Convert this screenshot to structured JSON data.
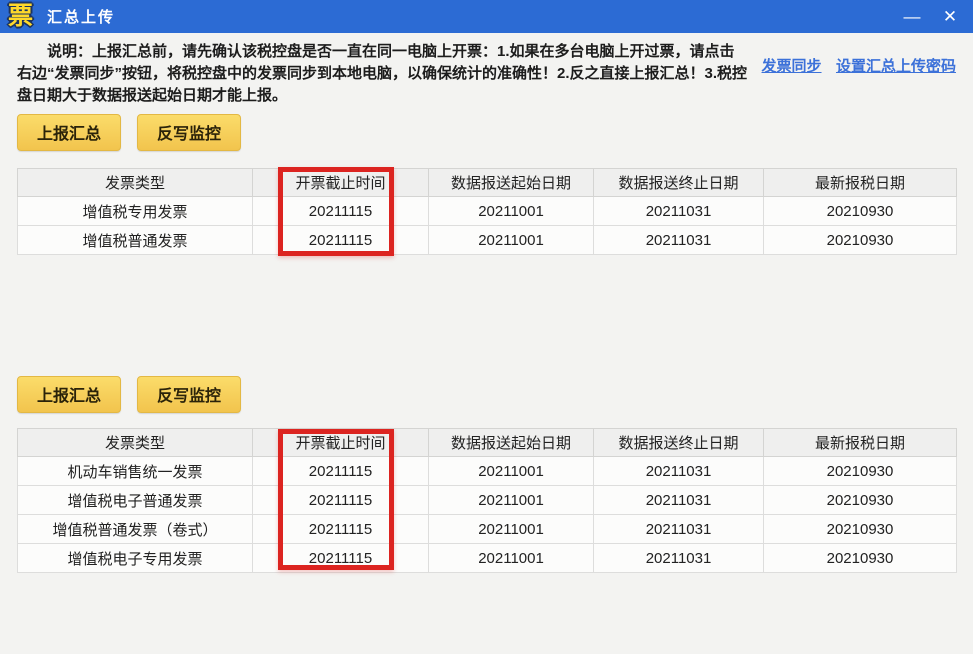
{
  "window": {
    "icon_glyph": "票",
    "title": "汇总上传",
    "minimize_glyph": "—",
    "close_glyph": "✕"
  },
  "notice": {
    "text": "说明：上报汇总前，请先确认该税控盘是否一直在同一电脑上开票：1.如果在多台电脑上开过票，请点击右边“发票同步”按钮，将税控盘中的发票同步到本地电脑，以确保统计的准确性！2.反之直接上报汇总！3.税控盘日期大于数据报送起始日期才能上报。"
  },
  "links": {
    "invoice_sync": "发票同步",
    "set_upload_password": "设置汇总上传密码"
  },
  "buttons": {
    "report_summary": "上报汇总",
    "writeback_monitor": "反写监控"
  },
  "tables": {
    "headers": [
      "发票类型",
      "开票截止时间",
      "数据报送起始日期",
      "数据报送终止日期",
      "最新报税日期"
    ],
    "table1": {
      "rows": [
        [
          "增值税专用发票",
          "20211115",
          "20211001",
          "20211031",
          "20210930"
        ],
        [
          "增值税普通发票",
          "20211115",
          "20211001",
          "20211031",
          "20210930"
        ]
      ]
    },
    "table2": {
      "rows": [
        [
          "机动车销售统一发票",
          "20211115",
          "20211001",
          "20211031",
          "20210930"
        ],
        [
          "增值税电子普通发票",
          "20211115",
          "20211001",
          "20211031",
          "20210930"
        ],
        [
          "增值税普通发票（卷式）",
          "20211115",
          "20211001",
          "20211031",
          "20210930"
        ],
        [
          "增值税电子专用发票",
          "20211115",
          "20211001",
          "20211031",
          "20210930"
        ]
      ]
    }
  },
  "colors": {
    "titlebar_blue": "#2c6bd4",
    "highlight_red": "#dc2420",
    "button_yellow": "#f5cf57",
    "link_blue": "#3c71d9"
  }
}
